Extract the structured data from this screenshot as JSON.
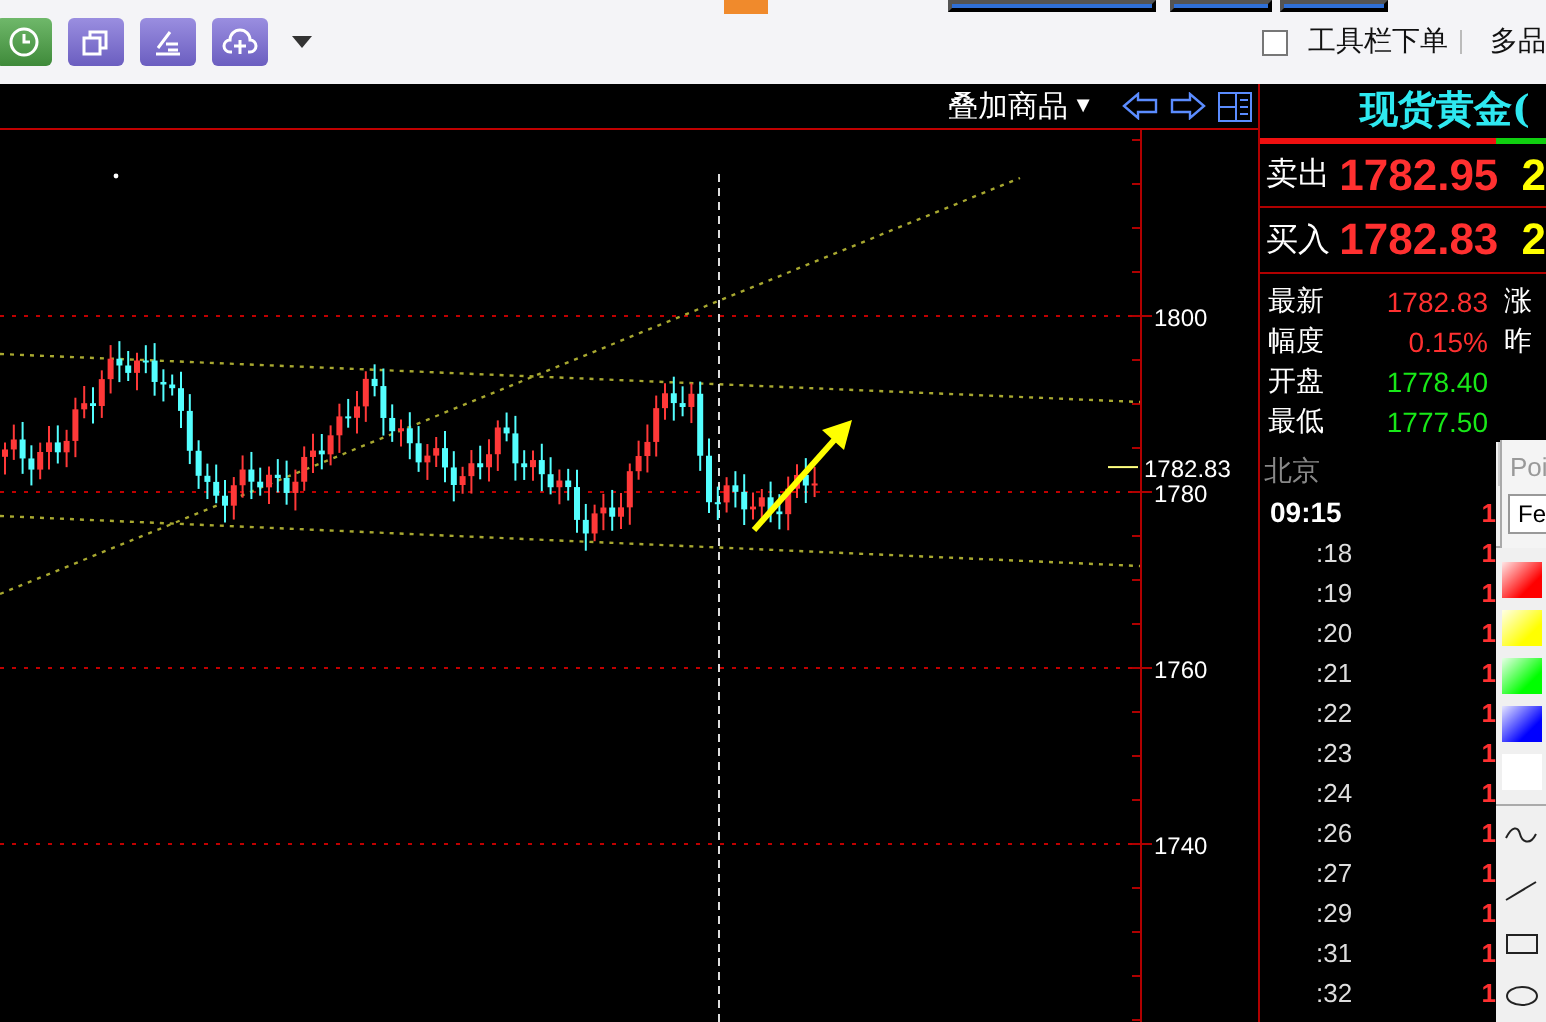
{
  "toolbar": {
    "order_checkbox": {
      "label": "工具栏下单",
      "checked": false
    },
    "multi_label": "多品"
  },
  "chart": {
    "header": {
      "overlay_button": "叠加商品",
      "caret": "▼"
    },
    "price_axis": [
      {
        "label": "1800",
        "kind": "grid"
      },
      {
        "label": "1780",
        "kind": "grid"
      },
      {
        "label": "1760",
        "kind": "grid"
      },
      {
        "label": "1740",
        "kind": "grid"
      }
    ],
    "current_price": "1782.83"
  },
  "quote": {
    "title": "现货黄金(",
    "sell": {
      "label": "卖出",
      "price": "1782.95",
      "extra": "2"
    },
    "buy": {
      "label": "买入",
      "price": "1782.83",
      "extra": "2"
    },
    "stats": [
      {
        "label": "最新",
        "value": "1782.83",
        "color": "#ff3030"
      },
      {
        "label": "幅度",
        "value": "0.15%",
        "color": "#ff3030"
      },
      {
        "label": "开盘",
        "value": "1778.40",
        "color": "#18e818"
      },
      {
        "label": "最低",
        "value": "1777.50",
        "color": "#18e818"
      }
    ],
    "side_labels": [
      "涨",
      "昨"
    ],
    "popup": {
      "title": "Poi",
      "button": "Fe"
    },
    "city": "北京",
    "ticks": [
      {
        "time": "09:15",
        "price": "1",
        "kind": "hour"
      },
      {
        "time": ":18",
        "price": "1",
        "kind": "minute"
      },
      {
        "time": ":19",
        "price": "1",
        "kind": "minute"
      },
      {
        "time": ":20",
        "price": "1",
        "kind": "minute"
      },
      {
        "time": ":21",
        "price": "1",
        "kind": "minute"
      },
      {
        "time": ":22",
        "price": "1",
        "kind": "minute"
      },
      {
        "time": ":23",
        "price": "1",
        "kind": "minute"
      },
      {
        "time": ":24",
        "price": "1",
        "kind": "minute"
      },
      {
        "time": ":26",
        "price": "1",
        "kind": "minute"
      },
      {
        "time": ":27",
        "price": "1",
        "kind": "minute"
      },
      {
        "time": ":29",
        "price": "1",
        "kind": "minute"
      },
      {
        "time": ":31",
        "price": "1",
        "kind": "minute"
      },
      {
        "time": ":32",
        "price": "1",
        "kind": "minute"
      }
    ]
  },
  "palette": {
    "swatches": [
      {
        "color": "#ff0000"
      },
      {
        "color": "#ffff00"
      },
      {
        "color": "#00ff00"
      },
      {
        "color": "#0000ff"
      },
      {
        "color": "#ffffff"
      }
    ]
  }
}
